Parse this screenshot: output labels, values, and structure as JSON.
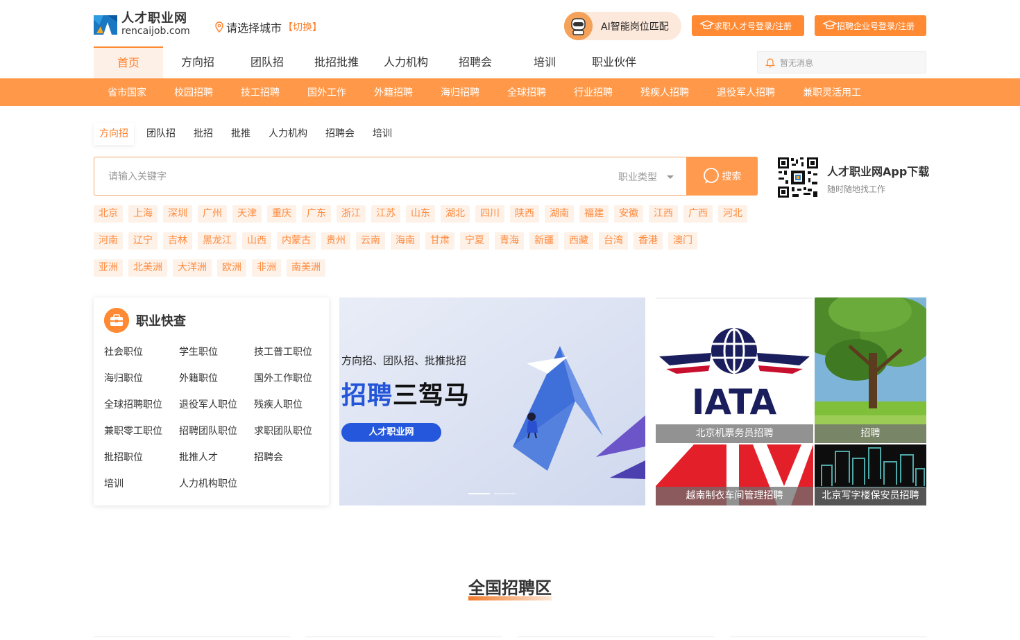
{
  "header": {
    "logo_cn": "人才职业网",
    "logo_en": "rencaijob.com",
    "city_prompt": "请选择城市",
    "city_switch": "【切换】",
    "ai_label": "AI智能岗位匹配",
    "seeker_login": "求职人才号登录/注册",
    "employer_login": "招聘企业号登录/注册",
    "message_placeholder": "暂无消息"
  },
  "main_nav": [
    "首页",
    "方向招",
    "团队招",
    "批招批推",
    "人力机构",
    "招聘会",
    "培训",
    "职业伙伴"
  ],
  "sub_nav": [
    "省市国家",
    "校园招聘",
    "技工招聘",
    "国外工作",
    "外籍招聘",
    "海归招聘",
    "全球招聘",
    "行业招聘",
    "残疾人招聘",
    "退役军人招聘",
    "兼职灵活用工"
  ],
  "search": {
    "tabs": [
      "方向招",
      "团队招",
      "批招",
      "批推",
      "人力机构",
      "招聘会",
      "培训"
    ],
    "placeholder": "请输入关键字",
    "job_type": "职业类型",
    "button": "搜索"
  },
  "app_download": {
    "title": "人才职业网App下载",
    "subtitle": "随时随地找工作"
  },
  "regions": [
    [
      "北京",
      "上海",
      "深圳",
      "广州",
      "天津",
      "重庆",
      "广东",
      "浙江",
      "江苏",
      "山东",
      "湖北",
      "四川",
      "陕西",
      "湖南",
      "福建",
      "安徽",
      "江西",
      "广西",
      "河北"
    ],
    [
      "河南",
      "辽宁",
      "吉林",
      "黑龙江",
      "山西",
      "内蒙古",
      "贵州",
      "云南",
      "海南",
      "甘肃",
      "宁夏",
      "青海",
      "新疆",
      "西藏",
      "台湾",
      "香港",
      "澳门"
    ],
    [
      "亚洲",
      "北美洲",
      "大洋洲",
      "欧洲",
      "非洲",
      "南美洲"
    ]
  ],
  "career_quick": {
    "title": "职业快查",
    "items": [
      "社会职位",
      "学生职位",
      "技工普工职位",
      "海归职位",
      "外籍职位",
      "国外工作职位",
      "全球招聘职位",
      "退役军人职位",
      "残疾人职位",
      "兼职零工职位",
      "招聘团队职位",
      "求职团队职位",
      "批招职位",
      "批推人才",
      "招聘会",
      "培训",
      "人力机构职位"
    ]
  },
  "banner": {
    "line1": "方向招、团队招、批推批招",
    "line2_blue": "招聘",
    "line2_rest": "三驾马",
    "pill": "人才职业网"
  },
  "tiles": {
    "iata_text": "IATA",
    "captions": [
      "北京机票务员招聘",
      "招聘",
      "越南制衣车间管理招聘",
      "北京写字楼保安员招聘"
    ]
  },
  "section_title": "全国招聘区",
  "colors": {
    "brand_orange": "#ff8a33",
    "subnav_orange": "#ff9949",
    "tag_bg": "#fdf1e8",
    "banner_blue": "#2457dc"
  }
}
